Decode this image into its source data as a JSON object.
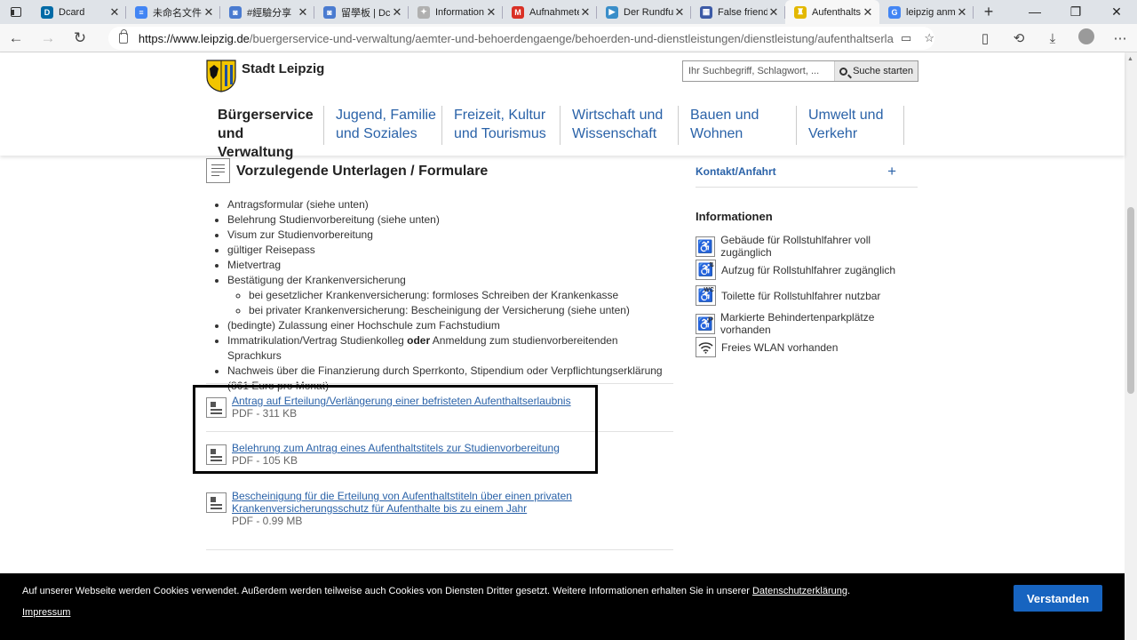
{
  "browser": {
    "tabs": [
      {
        "title": "Dcard",
        "favicon_color": "#006aa6",
        "favicon_letter": "D"
      },
      {
        "title": "未命名文件",
        "favicon_color": "#4285f4",
        "favicon_letter": "≡"
      },
      {
        "title": "#經驗分享",
        "favicon_color": "#4a7bd0",
        "favicon_letter": "◙"
      },
      {
        "title": "留學板 | Dc",
        "favicon_color": "#4a7bd0",
        "favicon_letter": "◙"
      },
      {
        "title": "Information",
        "favicon_color": "#b0b0b0",
        "favicon_letter": "✦"
      },
      {
        "title": "Aufnahmete",
        "favicon_color": "#d93025",
        "favicon_letter": "M"
      },
      {
        "title": "Der Rundfu",
        "favicon_color": "#3a8ec9",
        "favicon_letter": "▶"
      },
      {
        "title": "False friend",
        "favicon_color": "#3c5aa6",
        "favicon_letter": "▦"
      },
      {
        "title": "Aufenthalts",
        "favicon_color": "#e3b800",
        "favicon_letter": "♜"
      },
      {
        "title": "leipzig anm",
        "favicon_color": "#4285f4",
        "favicon_letter": "G"
      }
    ],
    "new_tab": "+",
    "url_host": "https://www.leipzig.de",
    "url_path": "/buergerservice-und-verwaltung/aemter-und-behoerdengaenge/behoerden-und-dienstleistungen/dienstleistung/aufenthaltserlaubnis-zur-stu..."
  },
  "header": {
    "logo_text": "Stadt Leipzig",
    "search_placeholder": "Ihr Suchbegriff, Schlagwort, ...",
    "search_button": "Suche starten",
    "nav": [
      {
        "line1": "Bürgerservice",
        "line2": "und Verwaltung"
      },
      {
        "line1": "Jugend, Familie",
        "line2": "und Soziales"
      },
      {
        "line1": "Freizeit, Kultur",
        "line2": "und Tourismus"
      },
      {
        "line1": "Wirtschaft und",
        "line2": "Wissenschaft"
      },
      {
        "line1": "Bauen und",
        "line2": "Wohnen"
      },
      {
        "line1": "Umwelt und",
        "line2": "Verkehr"
      }
    ]
  },
  "documents": {
    "title": "Vorzulegende Unterlagen / Formulare",
    "items": [
      "Antragsformular (siehe unten)",
      "Belehrung Studienvorbereitung (siehe unten)",
      "Visum zur Studienvorbereitung",
      "gültiger Reisepass",
      "Mietvertrag",
      "Bestätigung der Krankenversicherung"
    ],
    "sub_items": [
      "bei gesetzlicher Krankenversicherung: formloses Schreiben der Krankenkasse",
      "bei privater Krankenversicherung: Bescheinigung der Versicherung (siehe unten)"
    ],
    "item_admission": "(bedingte) Zulassung einer Hochschule zum Fachstudium",
    "item_enroll_a": "Immatrikulation/Vertrag Studienkolleg ",
    "item_enroll_or": "oder",
    "item_enroll_b": " Anmeldung zum studienvorbereitenden Sprachkurs",
    "item_finance": "Nachweis über die Finanzierung durch Sperrkonto, Stipendium oder Verpflichtungserklärung (861 Euro pro Monat)"
  },
  "files": [
    {
      "link": "Antrag auf Erteilung/Verlängerung einer befristeten Aufenthaltserlaubnis",
      "meta": "PDF - 311 KB"
    },
    {
      "link": "Belehrung zum Antrag eines Aufenthaltstitels zur Studienvorbereitung",
      "meta": "PDF - 105 KB"
    },
    {
      "link_line1": "Bescheinigung für die Erteilung von Aufenthaltstiteln über einen privaten",
      "link_line2": "Krankenversicherungsschutz für Aufenthalte bis zu einem Jahr",
      "meta": "PDF - 0.99 MB"
    }
  ],
  "sidebar": {
    "contact": "Kontakt/Anfahrt",
    "contact_toggle": "+",
    "info_title": "Informationen",
    "info_items": [
      {
        "icon": "wheelchair-icon",
        "text": "Gebäude für Rollstuhlfahrer voll zugänglich"
      },
      {
        "icon": "elevator-wheelchair-icon",
        "text": "Aufzug für Rollstuhlfahrer zugänglich"
      },
      {
        "icon": "wc-wheelchair-icon",
        "text": "Toilette für Rollstuhlfahrer nutzbar"
      },
      {
        "icon": "parking-wheelchair-icon",
        "text": "Markierte Behindertenparkplätze vorhanden"
      },
      {
        "icon": "wifi-icon",
        "text": "Freies WLAN vorhanden"
      }
    ]
  },
  "cookie": {
    "text": "Auf unserer Webseite werden Cookies verwendet. Außerdem werden teilweise auch Cookies von Diensten Dritter gesetzt. Weitere Informationen erhalten Sie in unserer ",
    "link": "Datenschutzerklärung",
    "suffix": ".",
    "impressum": "Impressum",
    "accept": "Verstanden"
  }
}
